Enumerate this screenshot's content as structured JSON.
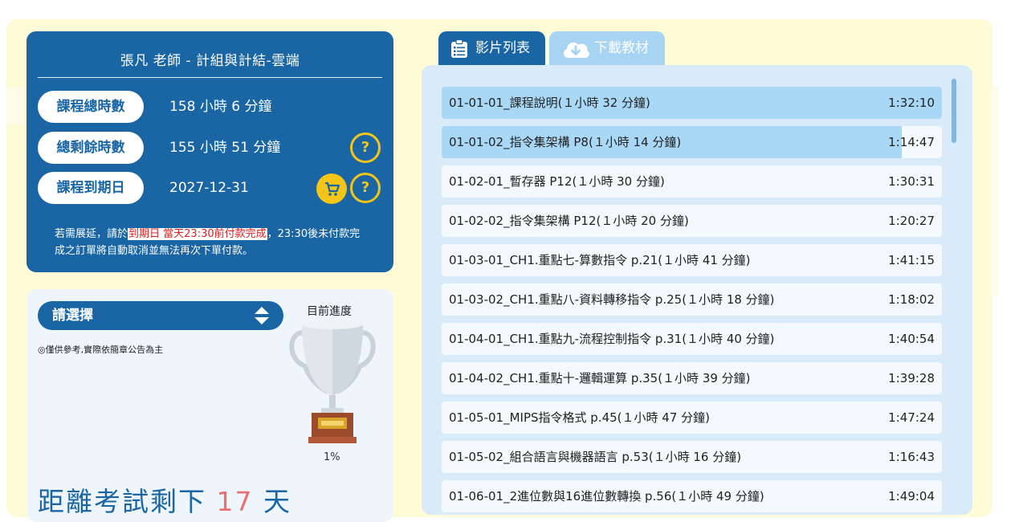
{
  "course": {
    "title": "張凡 老師 - 計組與計結-雲端",
    "stats": [
      {
        "label": "課程總時數",
        "value": "158 小時 6 分鐘"
      },
      {
        "label": "總剩餘時數",
        "value": "155 小時 51 分鐘"
      },
      {
        "label": "課程到期日",
        "value": "2027-12-31"
      }
    ],
    "help_symbol": "?",
    "notice_pre": "若需展延，請於",
    "notice_highlight": "到期日 當天23:30前付款完成",
    "notice_post": "，23:30後未付款完成之訂單將自動取消並無法再次下單付款。"
  },
  "progress": {
    "select_label": "請選擇",
    "reference_note": "◎僅供參考,實際依簡章公告為主",
    "progress_label": "目前進度",
    "progress_value": "1%",
    "progress_fraction": 0.01,
    "countdown_prefix": "距離考試剩下",
    "countdown_days": "17",
    "countdown_suffix": "天"
  },
  "tabs": [
    {
      "label": "影片列表",
      "icon": "clipboard-list-icon",
      "active": true
    },
    {
      "label": "下載教材",
      "icon": "cloud-download-icon",
      "active": false
    }
  ],
  "videos": [
    {
      "title": "01-01-01_課程說明(１小時 32 分鐘)",
      "time": "1:32:10",
      "watched_fraction": 1.0
    },
    {
      "title": "01-01-02_指令集架構 P8(１小時 14 分鐘)",
      "time": "1:14:47",
      "watched_fraction": 0.92
    },
    {
      "title": "01-02-01_暫存器 P12(１小時 30 分鐘)",
      "time": "1:30:31",
      "watched_fraction": 0
    },
    {
      "title": "01-02-02_指令集架構 P12(１小時 20 分鐘)",
      "time": "1:20:27",
      "watched_fraction": 0
    },
    {
      "title": "01-03-01_CH1.重點七-算數指令 p.21(１小時 41 分鐘)",
      "time": "1:41:15",
      "watched_fraction": 0
    },
    {
      "title": "01-03-02_CH1.重點八-資料轉移指令 p.25(１小時 18 分鐘)",
      "time": "1:18:02",
      "watched_fraction": 0
    },
    {
      "title": "01-04-01_CH1.重點九-流程控制指令 p.31(１小時 40 分鐘)",
      "time": "1:40:54",
      "watched_fraction": 0
    },
    {
      "title": "01-04-02_CH1.重點十-邏輯運算 p.35(１小時 39 分鐘)",
      "time": "1:39:28",
      "watched_fraction": 0
    },
    {
      "title": "01-05-01_MIPS指令格式 p.45(１小時 47 分鐘)",
      "time": "1:47:24",
      "watched_fraction": 0
    },
    {
      "title": "01-05-02_組合語言與機器語言 p.53(１小時 16 分鐘)",
      "time": "1:16:43",
      "watched_fraction": 0
    },
    {
      "title": "01-06-01_2進位數與16進位數轉換 p.56(１小時 49 分鐘)",
      "time": "1:49:04",
      "watched_fraction": 0
    }
  ],
  "colors": {
    "primary": "#1a66a4",
    "accent": "#f5c518",
    "watched": "#a9d8f7",
    "countdown_number": "#e8706e"
  }
}
